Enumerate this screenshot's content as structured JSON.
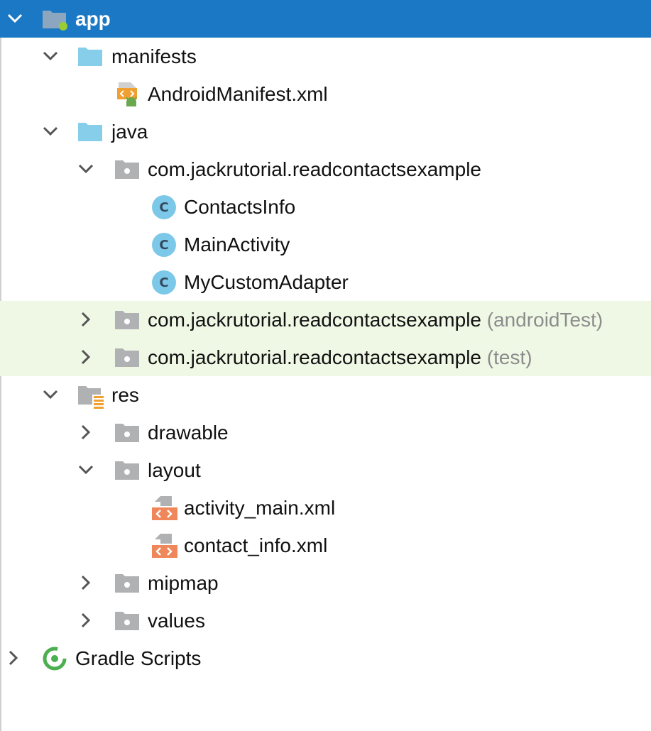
{
  "tree": {
    "root": {
      "label": "app",
      "expanded": true
    },
    "manifests": {
      "label": "manifests",
      "children": [
        {
          "label": "AndroidManifest.xml"
        }
      ]
    },
    "java": {
      "label": "java",
      "packages": [
        {
          "label": "com.jackrutorial.readcontactsexample",
          "suffix": "",
          "expanded": true,
          "classes": [
            {
              "icon": "C",
              "label": "ContactsInfo"
            },
            {
              "icon": "C",
              "label": "MainActivity"
            },
            {
              "icon": "C",
              "label": "MyCustomAdapter"
            }
          ]
        },
        {
          "label": "com.jackrutorial.readcontactsexample",
          "suffix": "(androidTest)",
          "expanded": false
        },
        {
          "label": "com.jackrutorial.readcontactsexample",
          "suffix": "(test)",
          "expanded": false
        }
      ]
    },
    "res": {
      "label": "res",
      "children": [
        {
          "label": "drawable",
          "expanded": false
        },
        {
          "label": "layout",
          "expanded": true,
          "files": [
            {
              "label": "activity_main.xml"
            },
            {
              "label": "contact_info.xml"
            }
          ]
        },
        {
          "label": "mipmap",
          "expanded": false
        },
        {
          "label": "values",
          "expanded": false
        }
      ]
    },
    "gradle": {
      "label": "Gradle Scripts",
      "expanded": false
    }
  },
  "colors": {
    "selection": "#1b78c4",
    "test_highlight": "#eff8e5",
    "source_folder": "#87ceeb",
    "package_folder": "#afb1b3",
    "class_icon": "#7cc8e8",
    "layout_file": "#f0875a",
    "gradle": "#4caf50"
  },
  "icons": {
    "expanded": "chevron-down-icon",
    "collapsed": "chevron-right-icon",
    "module": "module-folder-icon",
    "source_folder": "source-folder-icon",
    "package": "package-icon",
    "class": "class-icon",
    "manifest": "android-manifest-icon",
    "resources": "resources-folder-icon",
    "layout_file": "layout-xml-icon",
    "gradle": "gradle-icon"
  }
}
